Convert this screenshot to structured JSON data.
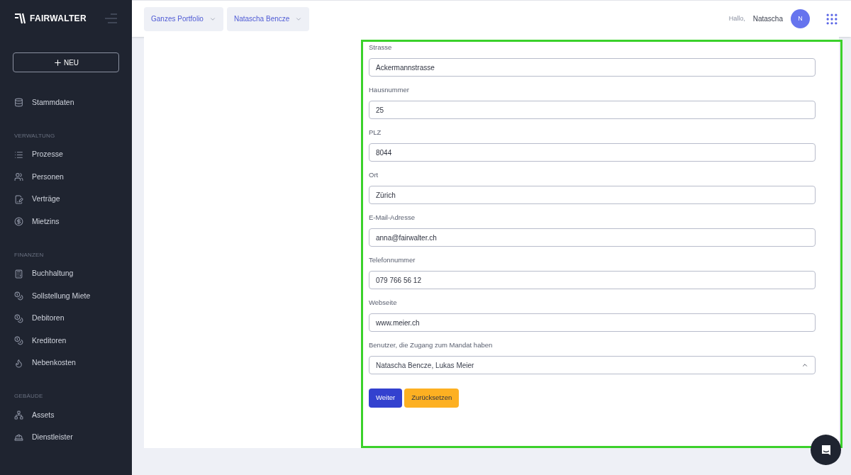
{
  "sidebar": {
    "logo": "FAIRWALTER",
    "new_button": "NEU",
    "sections": [
      {
        "items": [
          {
            "label": "Stammdaten",
            "kind": "database"
          }
        ]
      },
      {
        "heading": "VERWALTUNG",
        "items": [
          {
            "label": "Prozesse",
            "kind": "list"
          },
          {
            "label": "Personen",
            "kind": "users"
          },
          {
            "label": "Verträge",
            "kind": "contract"
          },
          {
            "label": "Mietzins",
            "kind": "coin"
          }
        ]
      },
      {
        "heading": "FINANZEN",
        "items": [
          {
            "label": "Buchhaltung",
            "kind": "calculator"
          },
          {
            "label": "Sollstellung Miete",
            "kind": "coins"
          },
          {
            "label": "Debitoren",
            "kind": "coins"
          },
          {
            "label": "Kreditoren",
            "kind": "coins"
          },
          {
            "label": "Nebenkosten",
            "kind": "flame"
          }
        ]
      },
      {
        "heading": "GEBÄUDE",
        "items": [
          {
            "label": "Assets",
            "kind": "network"
          },
          {
            "label": "Dienstleister",
            "kind": "worker"
          }
        ]
      }
    ]
  },
  "header": {
    "filters": [
      "Ganzes Portfolio",
      "Natascha Bencze"
    ],
    "greeting": "Hallo,",
    "user_name": "Natascha",
    "avatar_initial": "N"
  },
  "form": {
    "fields": [
      {
        "kind": "text",
        "label": "Strasse",
        "value": "Ackermannstrasse"
      },
      {
        "kind": "text",
        "label": "Hausnummer",
        "value": "25"
      },
      {
        "kind": "text",
        "label": "PLZ",
        "value": "8044"
      },
      {
        "kind": "text",
        "label": "Ort",
        "value": "Zürich"
      },
      {
        "kind": "text",
        "label": "E-Mail-Adresse",
        "value": "anna@fairwalter.ch"
      },
      {
        "kind": "text",
        "label": "Telefonnummer",
        "value": "079 766 56 12"
      },
      {
        "kind": "text",
        "label": "Webseite",
        "value": "www.meier.ch"
      },
      {
        "kind": "select",
        "label": "Benutzer, die Zugang zum Mandat haben",
        "value": "Natascha Bencze, Lukas Meier"
      }
    ],
    "buttons": [
      {
        "kind": "primary",
        "label": "Weiter"
      },
      {
        "kind": "warning",
        "label": "Zurücksetzen"
      }
    ]
  }
}
